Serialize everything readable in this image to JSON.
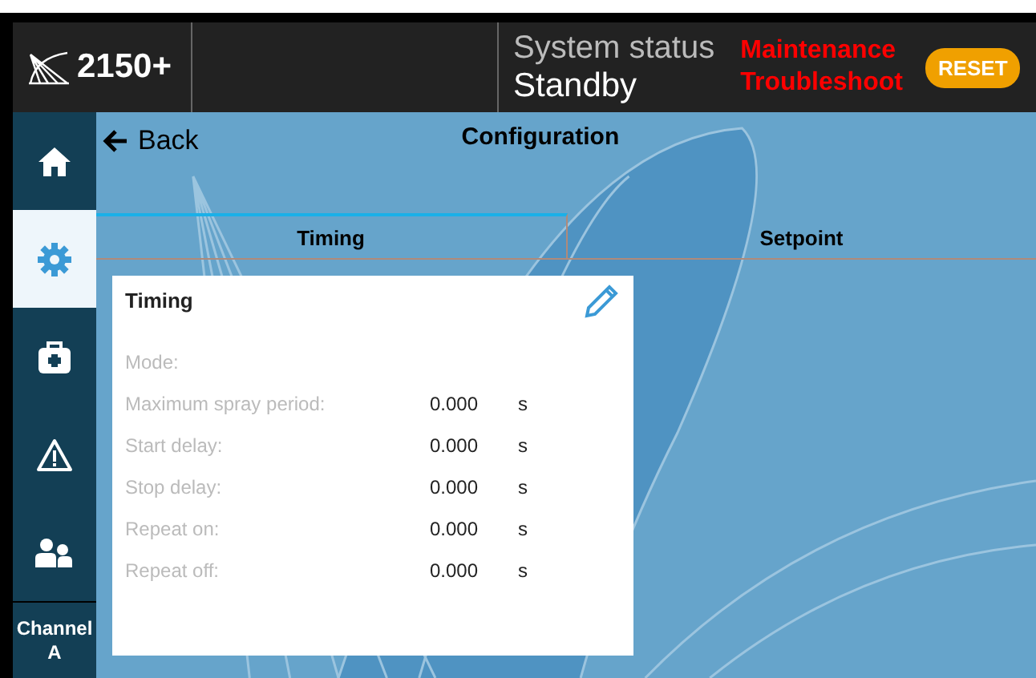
{
  "header": {
    "product": "2150+",
    "status_label": "System status",
    "status_value": "Standby",
    "alerts": [
      "Maintenance",
      "Troubleshoot"
    ],
    "reset_button": "RESET"
  },
  "sidebar": {
    "items": [
      {
        "kind": "home",
        "selected": false
      },
      {
        "kind": "settings",
        "selected": true
      },
      {
        "kind": "medkit",
        "selected": false
      },
      {
        "kind": "warning",
        "selected": false
      },
      {
        "kind": "users",
        "selected": false
      },
      {
        "kind": "channel",
        "label": "Channel A",
        "selected": false
      }
    ]
  },
  "back": "Back",
  "title": "Configuration",
  "tabs": [
    {
      "label": "Timing",
      "selected": true
    },
    {
      "label": "Setpoint",
      "selected": false
    }
  ],
  "card": {
    "title": "Timing",
    "rows": [
      {
        "label": "Mode:"
      },
      {
        "label": "Maximum spray period:",
        "value": "0.000",
        "unit": "s"
      },
      {
        "label": "Start delay:",
        "value": "0.000",
        "unit": "s"
      },
      {
        "label": "Stop delay:",
        "value": "0.000",
        "unit": "s"
      },
      {
        "label": "Repeat on:",
        "value": "0.000",
        "unit": "s"
      },
      {
        "label": "Repeat off:",
        "value": "0.000",
        "unit": "s"
      }
    ]
  }
}
